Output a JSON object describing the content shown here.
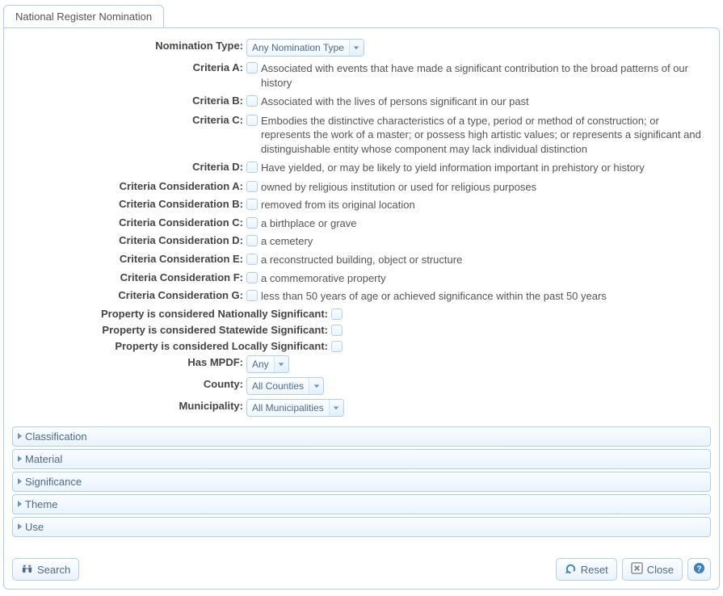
{
  "tab": {
    "label": "National Register Nomination"
  },
  "fields": {
    "nomination_type": {
      "label": "Nomination Type:",
      "value": "Any Nomination Type"
    },
    "criteria_a": {
      "label": "Criteria A:",
      "desc": "Associated with events that have made a significant contribution to the broad patterns of our history"
    },
    "criteria_b": {
      "label": "Criteria B:",
      "desc": "Associated with the lives of persons significant in our past"
    },
    "criteria_c": {
      "label": "Criteria C:",
      "desc": "Embodies the distinctive characteristics of a type, period or method of construction; or represents the work of a master; or possess high artistic values; or represents a significant and distinguishable entity whose component may lack individual distinction"
    },
    "criteria_d": {
      "label": "Criteria D:",
      "desc": "Have yielded, or may be likely to yield information important in prehistory or history"
    },
    "cc_a": {
      "label": "Criteria Consideration A:",
      "desc": "owned by religious institution or used for religious purposes"
    },
    "cc_b": {
      "label": "Criteria Consideration B:",
      "desc": "removed from its original location"
    },
    "cc_c": {
      "label": "Criteria Consideration C:",
      "desc": "a birthplace or grave"
    },
    "cc_d": {
      "label": "Criteria Consideration D:",
      "desc": "a cemetery"
    },
    "cc_e": {
      "label": "Criteria Consideration E:",
      "desc": "a reconstructed building, object or structure"
    },
    "cc_f": {
      "label": "Criteria Consideration F:",
      "desc": "a commemorative property"
    },
    "cc_g": {
      "label": "Criteria Consideration G:",
      "desc": "less than 50 years of age or achieved significance within the past 50 years"
    },
    "nationally": {
      "label": "Property is considered Nationally Significant:"
    },
    "statewide": {
      "label": "Property is considered Statewide Significant:"
    },
    "locally": {
      "label": "Property is considered Locally Significant:"
    },
    "has_mpdf": {
      "label": "Has MPDF:",
      "value": "Any"
    },
    "county": {
      "label": "County:",
      "value": "All Counties"
    },
    "municipality": {
      "label": "Municipality:",
      "value": "All Municipalities"
    }
  },
  "accordion": {
    "classification": "Classification",
    "material": "Material",
    "significance": "Significance",
    "theme": "Theme",
    "use": "Use"
  },
  "buttons": {
    "search": "Search",
    "reset": "Reset",
    "close": "Close"
  }
}
